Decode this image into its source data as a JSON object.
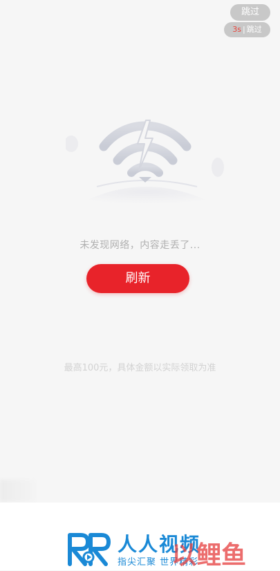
{
  "top_actions": {
    "skip_label": "跳过",
    "countdown_seconds": "3s",
    "countdown_separator": "|",
    "countdown_skip_label": "跳过"
  },
  "empty_state": {
    "icon": "no-wifi-icon",
    "message": "未发现网络，内容走丢了...",
    "refresh_label": "刷新"
  },
  "reward_note": "最高100元，具体金额以实际领取为准",
  "brand": {
    "name": "人人视频",
    "slogan": "指尖汇聚 世界精彩",
    "logo": "rr-logo"
  },
  "watermark": "以鲤鱼",
  "colors": {
    "accent": "#e8232a",
    "brand_blue": "#1a89d6",
    "countdown": "#e8453c",
    "background": "#f6f6f6"
  }
}
